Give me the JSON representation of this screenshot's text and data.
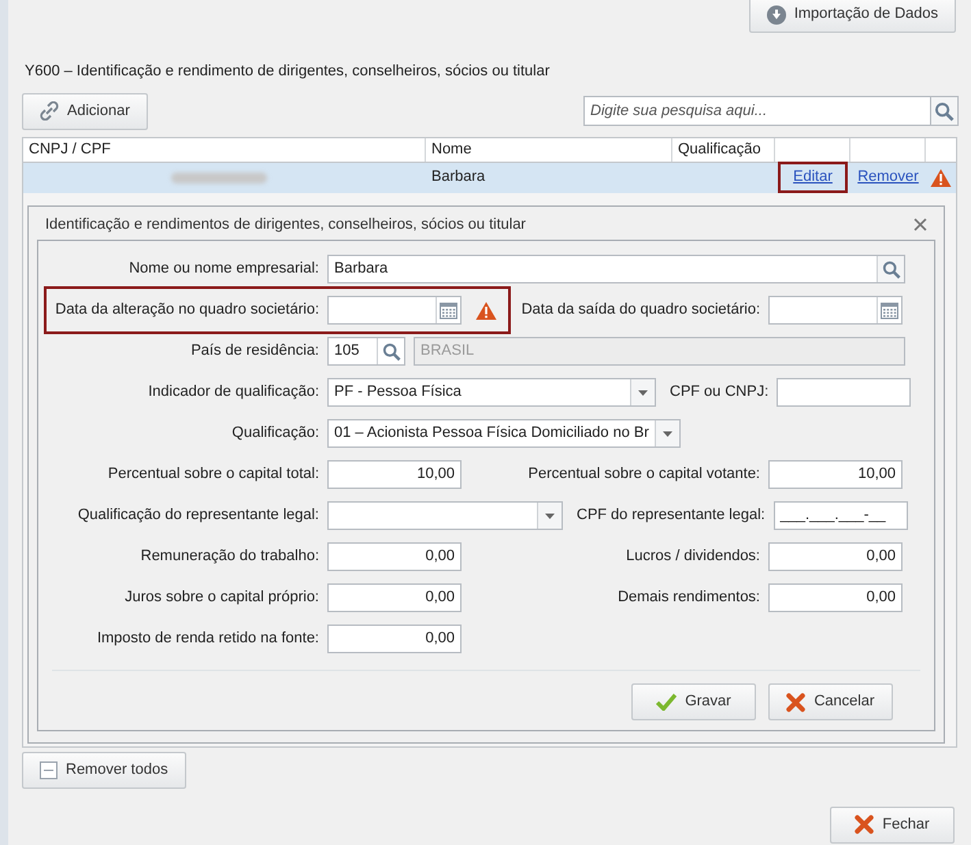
{
  "header": {
    "import_button": "Importação de Dados"
  },
  "section_title": "Y600 – Identificação e rendimento de dirigentes, conselheiros, sócios ou titular",
  "toolbar": {
    "add_button": "Adicionar",
    "search": {
      "placeholder": "Digite sua pesquisa aqui..."
    }
  },
  "table": {
    "columns": [
      "CNPJ / CPF",
      "Nome",
      "Qualificação"
    ],
    "rows": [
      {
        "nome": "Barbara",
        "selected": true,
        "actions": [
          {
            "label": "Editar",
            "highlighted": true
          },
          {
            "label": "Remover",
            "highlighted": false
          }
        ],
        "warning": true
      }
    ]
  },
  "dialog": {
    "title": "Identificação e rendimentos de dirigentes, conselheiros, sócios ou titular",
    "rows": [
      {
        "highlighted": false,
        "left": {
          "label": "Nome ou nome empresarial:",
          "kind": "lookup",
          "value": "Barbara"
        }
      },
      {
        "highlighted": true,
        "left": {
          "label": "Data da alteração no quadro societário:",
          "kind": "date",
          "warning": true
        },
        "right": {
          "label": "Data da saída do quadro societário:",
          "kind": "date",
          "warning": false
        }
      },
      {
        "highlighted": false,
        "left": {
          "label": "País de residência:",
          "kind": "country",
          "value": "105",
          "name": "BRASIL",
          "disabled": true
        }
      },
      {
        "highlighted": false,
        "left": {
          "label": "Indicador de qualificação:",
          "kind": "select",
          "value": "PF - Pessoa Física"
        },
        "right": {
          "label": "CPF ou CNPJ:",
          "kind": "text"
        }
      },
      {
        "highlighted": false,
        "left": {
          "label": "Qualificação:",
          "kind": "select",
          "value": "01 – Acionista Pessoa Física Domiciliado no Br"
        }
      },
      {
        "highlighted": false,
        "left": {
          "label": "Percentual sobre o capital total:",
          "kind": "number",
          "value": "10,00"
        },
        "right": {
          "label": "Percentual sobre o capital votante:",
          "kind": "number",
          "value": "10,00"
        }
      },
      {
        "highlighted": false,
        "left": {
          "label": "Qualificação do representante legal:",
          "kind": "select"
        },
        "right": {
          "label": "CPF do representante legal:",
          "kind": "text",
          "value": "___.___.___-__"
        }
      },
      {
        "highlighted": false,
        "left": {
          "label": "Remuneração do trabalho:",
          "kind": "number",
          "value": "0,00"
        },
        "right": {
          "label": "Lucros / dividendos:",
          "kind": "number",
          "value": "0,00"
        }
      },
      {
        "highlighted": false,
        "left": {
          "label": "Juros sobre o capital próprio:",
          "kind": "number",
          "value": "0,00"
        },
        "right": {
          "label": "Demais rendimentos:",
          "kind": "number",
          "value": "0,00"
        }
      },
      {
        "highlighted": false,
        "left": {
          "label": "Imposto de renda retido na fonte:",
          "kind": "number",
          "value": "0,00"
        }
      }
    ],
    "buttons": [
      {
        "label": "Gravar",
        "kind": "save"
      },
      {
        "label": "Cancelar",
        "kind": "cancel"
      }
    ]
  },
  "footer": {
    "remove_all_button": "Remover todos",
    "close_button": "Fechar"
  }
}
